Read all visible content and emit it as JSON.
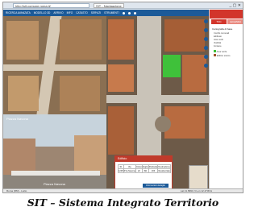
{
  "browser": {
    "address": "http://sit.comune.roma.it/",
    "tab_title": "SIT - Navigazione",
    "window_controls": "_ ▢ ✕"
  },
  "navbar": {
    "items": [
      "RICERCA AVANZATA",
      "MODELLO 3D",
      "ARRIVO",
      "INFO",
      "CATASTO",
      "SERVIZI",
      "STRUMENTI"
    ]
  },
  "left_panel": {
    "streetview_title": "Piazza Navona",
    "streetview_caption": "Piazza Navona"
  },
  "sidebar": {
    "tabs": [
      "TOC",
      "LEGENDA"
    ],
    "layer_group_title": "Cartografia di base",
    "layers": [
      "Confini comunali",
      "Edificato",
      "Aree verdi",
      "Viabilità",
      "Fontane"
    ],
    "legend_items": [
      "Area verde",
      "Edificio storico"
    ]
  },
  "popup": {
    "title": "Edificio",
    "table_headers": [
      "ID",
      "Via",
      "Civico",
      "Foglio",
      "Particella",
      "Destinazione"
    ],
    "table_values": [
      "1205",
      "P.za Navona",
      "22",
      "491",
      "183",
      "Residenziale"
    ],
    "button_label": "Informazioni dettaglio"
  },
  "statusbar": {
    "left_text": "Roma (RM) - Lazio",
    "right_text": "Lat 41.8991 N  Lon 12.4730 E"
  },
  "caption": "SIT – Sistema Integrato Territorio",
  "colors": {
    "nav_blue": "#1c5a98",
    "accent_red": "#d2352b",
    "green_area": "#3fc13a"
  }
}
